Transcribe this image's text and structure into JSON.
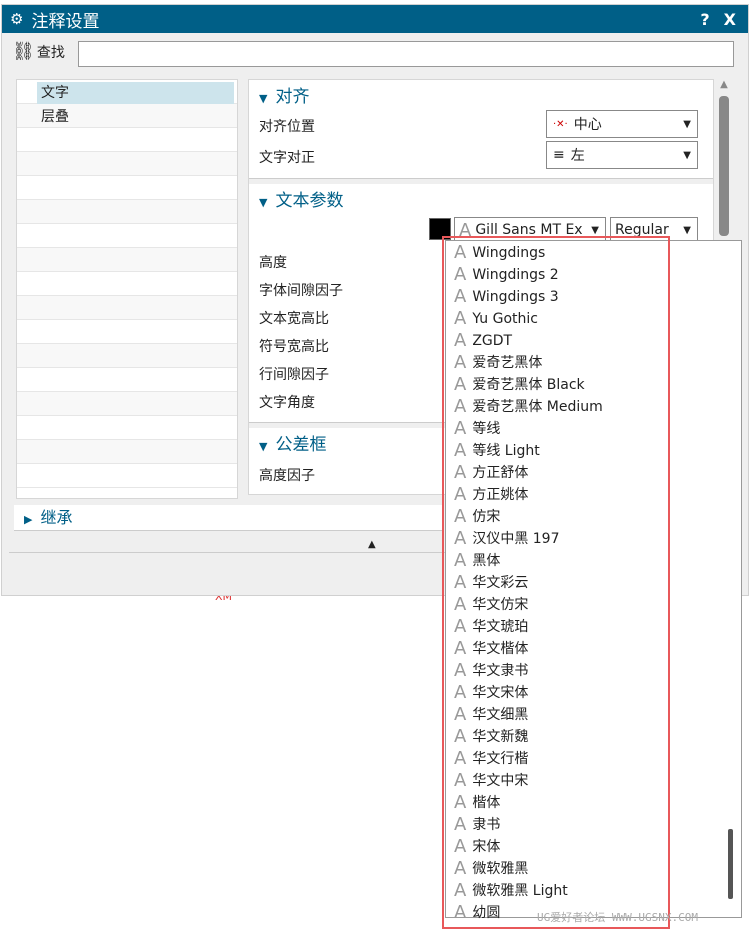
{
  "title": "注释设置",
  "help": "?",
  "close": "X",
  "find_label": "查找",
  "tree": [
    "文字",
    "层叠"
  ],
  "sections": {
    "align": "对齐",
    "text_params": "文本参数",
    "tolerance": "公差框",
    "inherit": "继承"
  },
  "labels": {
    "align_pos": "对齐位置",
    "text_just": "文字对正",
    "height": "高度",
    "char_gap": "字体间隙因子",
    "text_aspect": "文本宽高比",
    "sym_aspect": "符号宽高比",
    "line_gap": "行间隙因子",
    "angle": "文字角度",
    "height_factor": "高度因子"
  },
  "align_pos_value": "中心",
  "text_just_value": "左",
  "font_value": "Gill Sans MT Ex",
  "style_value": "Regular",
  "color": "#000000",
  "font_list": [
    "Wingdings",
    "Wingdings 2",
    "Wingdings 3",
    "Yu Gothic",
    "ZGDT",
    "爱奇艺黑体",
    "爱奇艺黑体 Black",
    "爱奇艺黑体 Medium",
    "等线",
    "等线 Light",
    "方正舒体",
    "方正姚体",
    "仿宋",
    "汉仪中黑 197",
    "黑体",
    "华文彩云",
    "华文仿宋",
    "华文琥珀",
    "华文楷体",
    "华文隶书",
    "华文宋体",
    "华文细黑",
    "华文新魏",
    "华文行楷",
    "华文中宋",
    "楷体",
    "隶书",
    "宋体",
    "微软雅黑",
    "微软雅黑 Light",
    "幼圆"
  ],
  "watermark": "UG爱好者论坛 WWW.UGSNX.COM",
  "background_text": "XM"
}
